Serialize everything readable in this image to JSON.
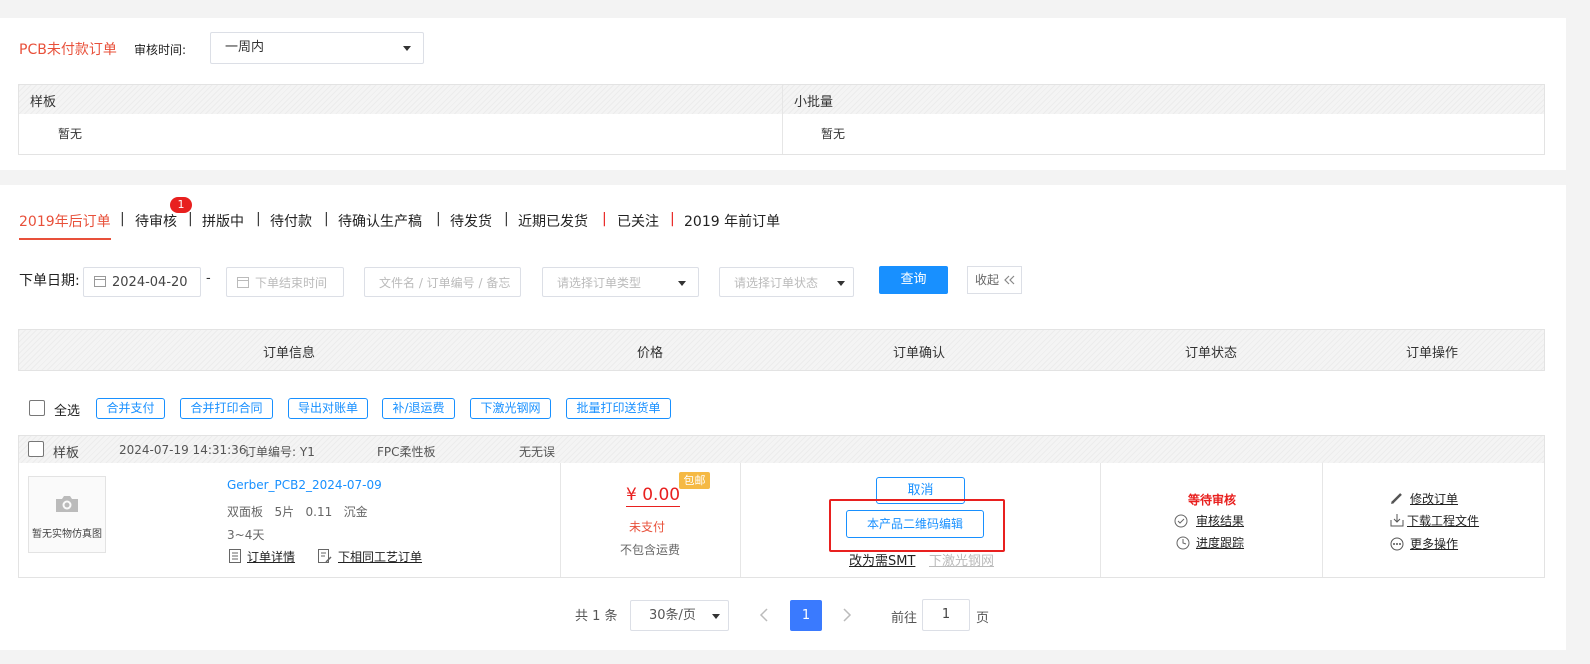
{
  "filter_card": {
    "title": "PCB未付款订单",
    "audit_time_label": "审核时间:",
    "audit_time_value": "一周内",
    "columns": [
      {
        "header": "样板",
        "value": "暂无"
      },
      {
        "header": "小批量",
        "value": "暂无"
      }
    ]
  },
  "tabs": [
    {
      "label": "2019年后订单",
      "active": true
    },
    {
      "label": "待审核",
      "badge": "1"
    },
    {
      "label": "拼版中"
    },
    {
      "label": "待付款"
    },
    {
      "label": "待确认生产稿"
    },
    {
      "label": "待发货"
    },
    {
      "label": "近期已发货"
    },
    {
      "label": "已关注"
    },
    {
      "label": "2019 年前订单"
    }
  ],
  "separator": "|",
  "search": {
    "date_label": "下单日期:",
    "start_date": "2024-04-20",
    "dash": "-",
    "end_date_placeholder": "下单结束时间",
    "keyword_placeholder": "文件名 / 订单编号 / 备忘",
    "order_type_placeholder": "请选择订单类型",
    "order_status_placeholder": "请选择订单状态",
    "query_button": "查询",
    "collapse_button": "收起"
  },
  "table_headers": [
    "订单信息",
    "价格",
    "订单确认",
    "订单状态",
    "订单操作"
  ],
  "toolbar": {
    "select_all": "全选",
    "buttons": [
      "合并支付",
      "合并打印合同",
      "导出对账单",
      "补/退运费",
      "下激光钢网",
      "批量打印送货单"
    ]
  },
  "order": {
    "type": "样板",
    "datetime": "2024-07-19 14:31:36",
    "order_no": "订单编号: Y1",
    "material": "FPC柔性板",
    "note": "无无误",
    "image_placeholder": "暂无实物仿真图",
    "filename": "Gerber_PCB2_2024-07-09",
    "spec": "双面板   5片   0.11   沉金",
    "lead_time": "3~4天",
    "detail_link": "订单详情",
    "reorder_link": "下相同工艺订单",
    "price": "¥ 0.00",
    "free_shipping_badge": "包邮",
    "pay_status": "未支付",
    "shipping_note": "不包含运费",
    "cancel_button": "取消",
    "qr_edit_button": "本产品二维码编辑",
    "change_smt_link": "改为需SMT",
    "laser_stencil_link": "下激光钢网",
    "status": "等待审核",
    "audit_result_link": "审核结果",
    "progress_link": "进度跟踪",
    "modify_link": "修改订单",
    "download_link": "下载工程文件",
    "more_link": "更多操作"
  },
  "pagination": {
    "total": "共 1 条",
    "page_size": "30条/页",
    "current_page": "1",
    "goto_label": "前往",
    "goto_value": "1",
    "page_unit": "页"
  },
  "colors": {
    "accent_red": "#e8503a",
    "primary_blue": "#1890ff",
    "highlight_box": "#e8201f"
  }
}
